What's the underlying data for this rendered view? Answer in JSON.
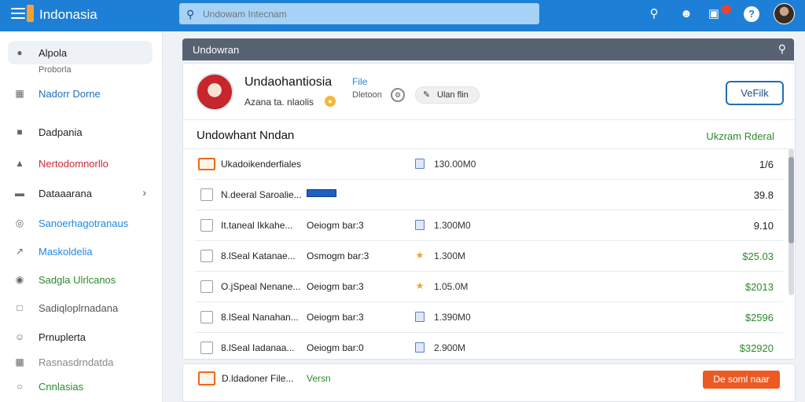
{
  "app": {
    "brand": "Indonasia"
  },
  "search": {
    "placeholder": "Undowam Intecnam"
  },
  "sidebar": {
    "items": [
      {
        "label": "Alpola",
        "icon": "chat-icon",
        "color": "#222222",
        "sub": "Proborla"
      },
      {
        "label": "Nadorr Dorne",
        "icon": "calendar-icon",
        "color": "#1e6fc2"
      },
      {
        "label": "Dadpania",
        "icon": "briefcase-icon",
        "color": "#222222"
      },
      {
        "label": "Nertodomnorllo",
        "icon": "bell-icon",
        "color": "#c8283a"
      },
      {
        "label": "Dataaarana",
        "icon": "inbox-icon",
        "color": "#222222"
      },
      {
        "label": "Sanoerhagotranaus",
        "icon": "target-icon",
        "color": "#1e88e5"
      },
      {
        "label": "Maskoldelia",
        "icon": "link-icon",
        "color": "#1e88e5"
      },
      {
        "label": "Sadgla Ulrlcanos",
        "icon": "user-circle-icon",
        "color": "#2c8a2c"
      },
      {
        "label": "Sadiqloplrnadana",
        "icon": "document-icon",
        "color": "#555555"
      },
      {
        "label": "Prnuplerta",
        "icon": "users-icon",
        "color": "#222222"
      },
      {
        "label": "Rasnasdrndatda",
        "icon": "grid-icon",
        "color": "#888888"
      },
      {
        "label": "Cnnlasias",
        "icon": "globe-icon",
        "color": "#2c8a2c"
      }
    ]
  },
  "panel": {
    "title": "Undowran"
  },
  "profile": {
    "name": "Undaohantiosia",
    "subtitle": "Azana ta. nlaolis",
    "file_link": "File",
    "meta": "Dletoon",
    "pill_label": "Ulan flin",
    "action_label": "VeFilk"
  },
  "files": {
    "title": "Undowhant Nndan",
    "right_label": "Ukzram Rderal",
    "rows": [
      {
        "name": "Ukadoikenderfiales",
        "meta": "",
        "size": "130.00M0",
        "value": "1/6",
        "green": false,
        "folder": true,
        "icon": "doc",
        "tag": false
      },
      {
        "name": "N.deeral Saroalie...",
        "meta": "",
        "size": "",
        "value": "39.8",
        "green": false,
        "folder": false,
        "icon": "",
        "tag": true
      },
      {
        "name": "It.taneal Ikkahe...",
        "meta": "Oeiogm bar:3",
        "size": "1.300M0",
        "value": "9.10",
        "green": false,
        "folder": false,
        "icon": "doc",
        "tag": false
      },
      {
        "name": "8.lSeal Katanae...",
        "meta": "Osmogm bar:3",
        "size": "1.300M",
        "value": "$25.03",
        "green": true,
        "folder": false,
        "icon": "pin",
        "tag": false
      },
      {
        "name": "O.jSpeal Nenane...",
        "meta": "Oeiogm bar:3",
        "size": "1.05.0M",
        "value": "$2013",
        "green": true,
        "folder": false,
        "icon": "pin",
        "tag": false
      },
      {
        "name": "8.lSeal Nanahan...",
        "meta": "Oeiogm bar:3",
        "size": "1.390M0",
        "value": "$2596",
        "green": true,
        "folder": false,
        "icon": "doc",
        "tag": false
      },
      {
        "name": "8.lSeal Iadanaa...",
        "meta": "Oeiogm bar:0",
        "size": "2.900M",
        "value": "$32920",
        "green": true,
        "folder": false,
        "icon": "doc",
        "tag": false
      }
    ]
  },
  "bottom": {
    "name": "D.ldadoner File...",
    "version": "Versn",
    "button": "De soml naar"
  },
  "colors": {
    "topbar": "#1e7fd6",
    "accent": "#1f6fb8",
    "danger": "#ec5a23",
    "positive": "#2c8a2c"
  }
}
